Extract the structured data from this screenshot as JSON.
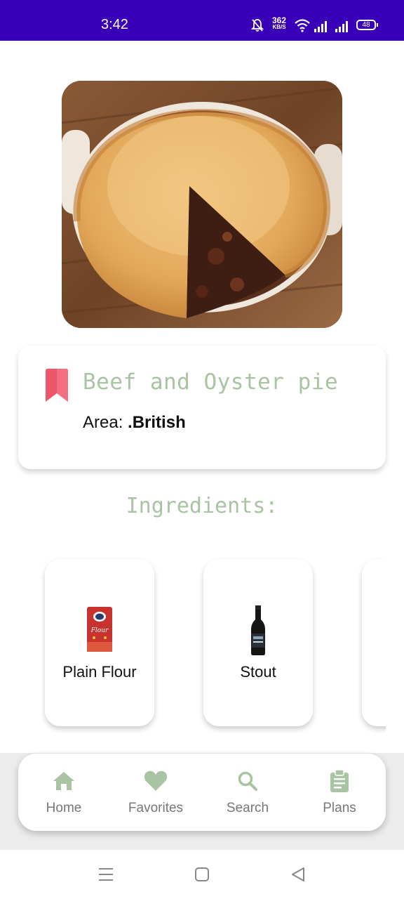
{
  "status_bar": {
    "time": "3:42",
    "net_speed_value": "362",
    "net_speed_unit": "KB/S",
    "battery": "48",
    "icons": [
      "bell-off-icon",
      "wifi-icon",
      "signal-icon",
      "signal-icon",
      "battery-icon"
    ]
  },
  "meal": {
    "title": "Beef and Oyster pie",
    "area_label": "Area:",
    "area_value": ".British",
    "bookmark_color": "#f0566a"
  },
  "ingredients": {
    "heading": "Ingredients:",
    "items": [
      {
        "name": "Plain Flour",
        "icon": "flour-bag-icon"
      },
      {
        "name": "Stout",
        "icon": "beer-bottle-icon"
      },
      {
        "name": "",
        "icon": ""
      }
    ]
  },
  "bottom_nav": {
    "items": [
      {
        "label": "Home",
        "icon": "home-icon"
      },
      {
        "label": "Favorites",
        "icon": "heart-icon"
      },
      {
        "label": "Search",
        "icon": "search-icon"
      },
      {
        "label": "Plans",
        "icon": "clipboard-icon"
      }
    ],
    "icon_color": "#a8c4a2"
  },
  "colors": {
    "status_bar": "#3a00b8",
    "accent_text": "#a8c4a2"
  }
}
